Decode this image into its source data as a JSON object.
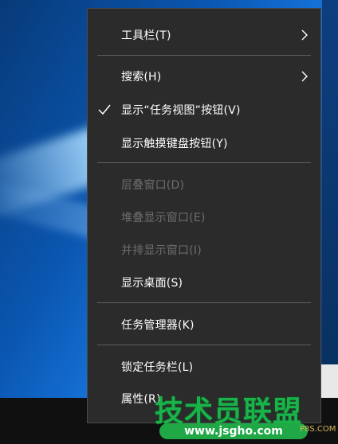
{
  "menu": {
    "items": [
      {
        "label": "工具栏(T)",
        "has_submenu": true,
        "checked": false,
        "enabled": true
      },
      {
        "label": "搜索(H)",
        "has_submenu": true,
        "checked": false,
        "enabled": true
      },
      {
        "label": "显示“任务视图”按钮(V)",
        "has_submenu": false,
        "checked": true,
        "enabled": true
      },
      {
        "label": "显示触摸键盘按钮(Y)",
        "has_submenu": false,
        "checked": false,
        "enabled": true
      },
      {
        "label": "层叠窗口(D)",
        "has_submenu": false,
        "checked": false,
        "enabled": false
      },
      {
        "label": "堆叠显示窗口(E)",
        "has_submenu": false,
        "checked": false,
        "enabled": false
      },
      {
        "label": "并排显示窗口(I)",
        "has_submenu": false,
        "checked": false,
        "enabled": false
      },
      {
        "label": "显示桌面(S)",
        "has_submenu": false,
        "checked": false,
        "enabled": true
      },
      {
        "label": "任务管理器(K)",
        "has_submenu": false,
        "checked": false,
        "enabled": true
      },
      {
        "label": "锁定任务栏(L)",
        "has_submenu": false,
        "checked": false,
        "enabled": true
      },
      {
        "label": "属性(R)",
        "has_submenu": false,
        "checked": false,
        "enabled": true
      }
    ],
    "colors": {
      "background": "#2b2b2b",
      "text": "#ffffff",
      "disabled_text": "#6d6d6d",
      "separator": "#5e5e5e"
    }
  },
  "watermark": {
    "title": "技术员联盟",
    "url": "www.jsgho.com",
    "sub": "P8S.COM",
    "color": "#19b34a"
  }
}
